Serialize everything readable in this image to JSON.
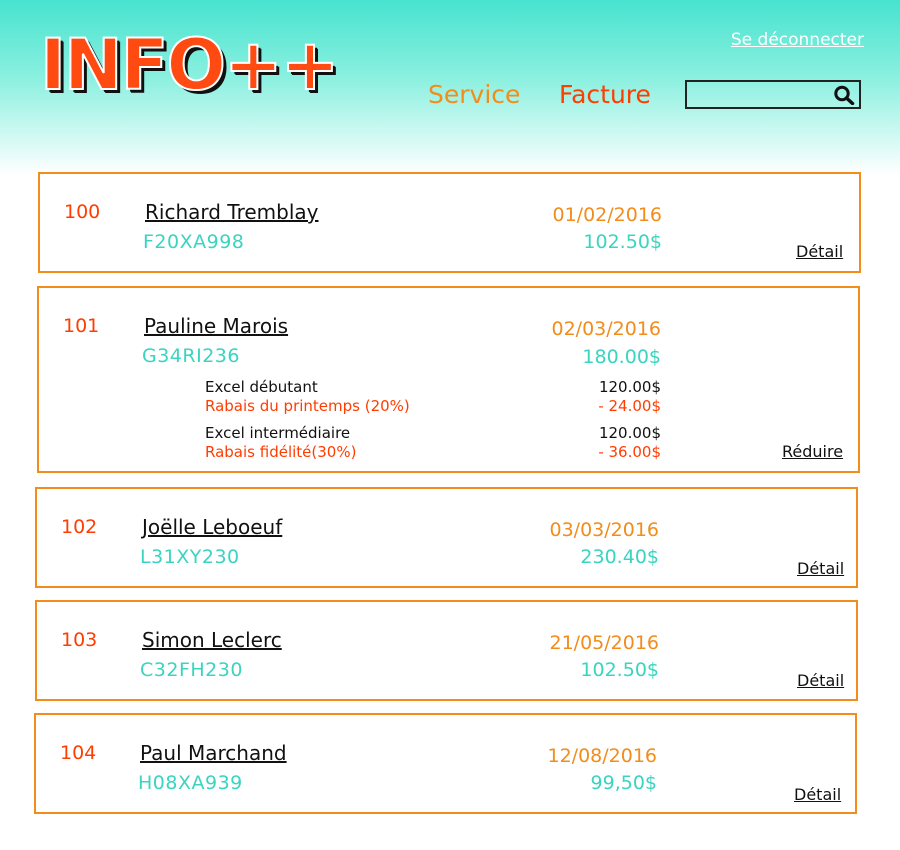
{
  "header": {
    "logo": "INFO++",
    "logout_label": "Se déconnecter",
    "nav": {
      "service": "Service",
      "facture": "Facture"
    },
    "search": {
      "value": "",
      "placeholder": ""
    }
  },
  "colors": {
    "accent_orange": "#f28c1a",
    "accent_red": "#ff3d00",
    "teal": "#3ad4c0",
    "header_teal": "#47e3cf"
  },
  "invoices": [
    {
      "id": "100",
      "name": "Richard Tremblay",
      "code": "F20XA998",
      "date": "01/02/2016",
      "amount": "102.50$",
      "action": "Détail"
    },
    {
      "id": "101",
      "name": "Pauline Marois",
      "code": "G34RI236",
      "date": "02/03/2016",
      "amount": "180.00$",
      "action": "Réduire",
      "items": [
        {
          "label": "Excel débutant",
          "price": "120.00$",
          "discount_label": "Rabais du printemps (20%)",
          "discount": "- 24.00$"
        },
        {
          "label": "Excel intermédiaire",
          "price": "120.00$",
          "discount_label": "Rabais fidélité(30%)",
          "discount": "- 36.00$"
        }
      ]
    },
    {
      "id": "102",
      "name": "Joëlle Leboeuf",
      "code": "L31XY230",
      "date": "03/03/2016",
      "amount": "230.40$",
      "action": "Détail"
    },
    {
      "id": "103",
      "name": "Simon Leclerc",
      "code": "C32FH230",
      "date": "21/05/2016",
      "amount": "102.50$",
      "action": "Détail"
    },
    {
      "id": "104",
      "name": "Paul Marchand",
      "code": "H08XA939",
      "date": "12/08/2016",
      "amount": "99,50$",
      "action": "Détail"
    }
  ]
}
